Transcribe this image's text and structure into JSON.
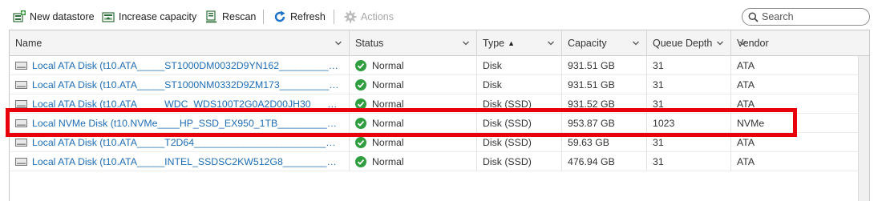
{
  "toolbar": {
    "new_datastore": "New datastore",
    "increase_capacity": "Increase capacity",
    "rescan": "Rescan",
    "refresh": "Refresh",
    "actions": "Actions"
  },
  "search": {
    "placeholder": "Search"
  },
  "columns": {
    "name": "Name",
    "status": "Status",
    "type": "Type",
    "type_sort": "▲",
    "capacity": "Capacity",
    "queue_depth": "Queue Depth",
    "vendor": "Vendor"
  },
  "rows": [
    {
      "name": "Local ATA Disk (t10.ATA_____ST1000DM0032D9YN162________________",
      "status": "Normal",
      "type": "Disk",
      "capacity": "931.51 GB",
      "queue_depth": "31",
      "vendor": "ATA"
    },
    {
      "name": "Local ATA Disk (t10.ATA_____ST1000NM0332D9ZM173________________",
      "status": "Normal",
      "type": "Disk",
      "capacity": "931.51 GB",
      "queue_depth": "31",
      "vendor": "ATA"
    },
    {
      "name": "Local ATA Disk (t10.ATA_____WDC_WDS100T2G0A2D00JH30_____________",
      "status": "Normal",
      "type": "Disk (SSD)",
      "capacity": "931.52 GB",
      "queue_depth": "31",
      "vendor": "ATA"
    },
    {
      "name": "Local NVMe Disk (t10.NVMe____HP_SSD_EX950_1TB______________________",
      "status": "Normal",
      "type": "Disk (SSD)",
      "capacity": "953.87 GB",
      "queue_depth": "1023",
      "vendor": "NVMe"
    },
    {
      "name": "Local ATA Disk (t10.ATA_____T2D64_____________________________________",
      "status": "Normal",
      "type": "Disk (SSD)",
      "capacity": "59.63 GB",
      "queue_depth": "31",
      "vendor": "ATA"
    },
    {
      "name": "Local ATA Disk (t10.ATA_____INTEL_SSDSC2KW512G8_______________________",
      "status": "Normal",
      "type": "Disk (SSD)",
      "capacity": "476.94 GB",
      "queue_depth": "31",
      "vendor": "ATA"
    }
  ],
  "colors": {
    "link": "#1f6db5",
    "status_ok": "#2e9e3e",
    "highlight": "#e8000b",
    "refresh_icon": "#1e73c8"
  },
  "icons": {
    "new_datastore": "datastore-add-icon",
    "increase_capacity": "increase-capacity-icon",
    "rescan": "rescan-icon",
    "refresh": "refresh-icon",
    "actions": "gear-icon",
    "search": "search-icon",
    "disk": "disk-icon",
    "status": "check-circle-icon"
  }
}
